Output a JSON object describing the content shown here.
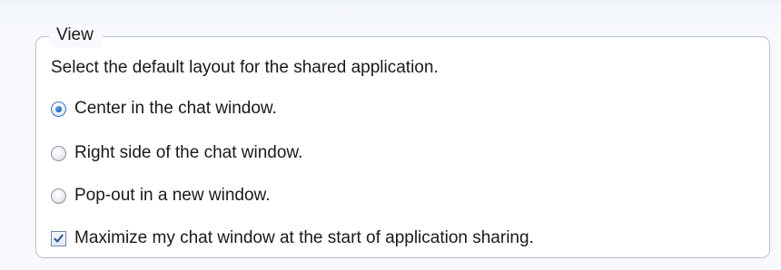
{
  "group": {
    "title": "View",
    "description": "Select the default layout for the shared application."
  },
  "layout_options": [
    {
      "label": "Center in the chat window.",
      "selected": true
    },
    {
      "label": "Right side of the chat window.",
      "selected": false
    },
    {
      "label": "Pop-out in a new window.",
      "selected": false
    }
  ],
  "maximize_option": {
    "label": "Maximize my chat window at the start of application sharing.",
    "checked": true
  },
  "colors": {
    "accent": "#1d63b8",
    "group_border": "#b9c2cd"
  }
}
